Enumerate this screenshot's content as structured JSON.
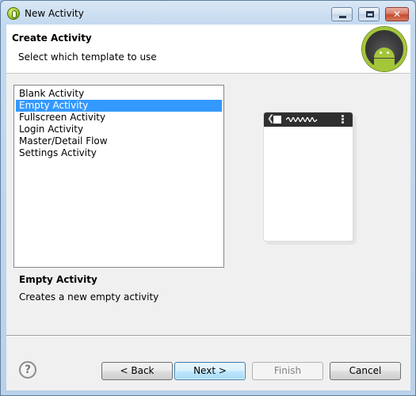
{
  "window": {
    "title": "New Activity"
  },
  "banner": {
    "title": "Create Activity",
    "description": "Select which template to use"
  },
  "templates": {
    "items": [
      "Blank Activity",
      "Empty Activity",
      "Fullscreen Activity",
      "Login Activity",
      "Master/Detail Flow",
      "Settings Activity"
    ],
    "selected": "Empty Activity"
  },
  "details": {
    "title": "Empty Activity",
    "description": "Creates a new empty activity"
  },
  "preview": {
    "back_glyph": "❮"
  },
  "help": {
    "glyph": "?"
  },
  "buttons": {
    "back": "< Back",
    "next": "Next >",
    "finish": "Finish",
    "cancel": "Cancel"
  },
  "icons": {
    "app": "android-studio-icon",
    "banner": "android-logo-icon",
    "help": "help-icon"
  },
  "colors": {
    "selection": "#3399ff",
    "android_green": "#a4c639"
  }
}
